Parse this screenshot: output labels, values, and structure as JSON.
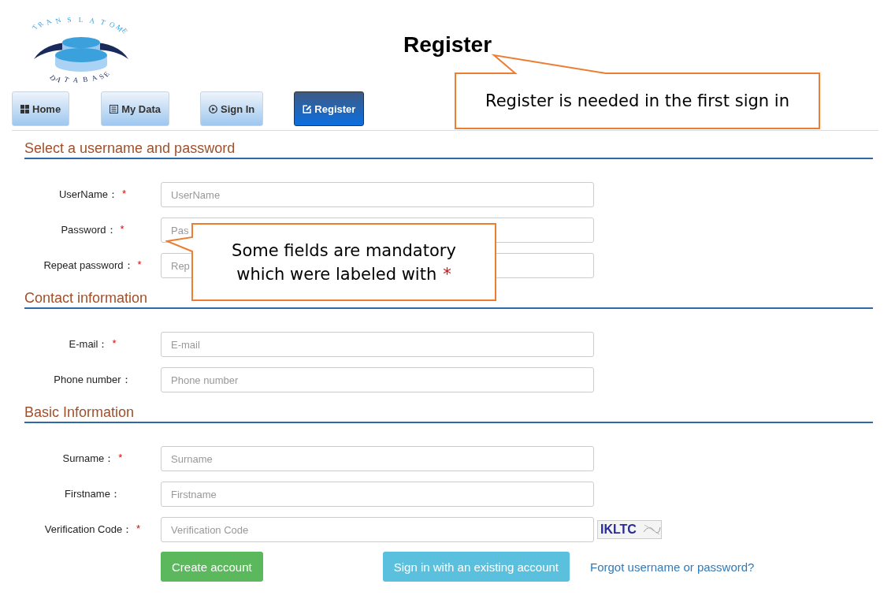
{
  "logo": {
    "top_text": "TRANSLATOME",
    "bottom_text": "DATABASE"
  },
  "title": "Register",
  "nav": [
    {
      "label": "Home",
      "selected": false
    },
    {
      "label": "My Data",
      "selected": false
    },
    {
      "label": "Sign In",
      "selected": false
    },
    {
      "label": "Register",
      "selected": true
    }
  ],
  "required_mark": "*",
  "sections": [
    {
      "heading": "Select a username and password",
      "fields": [
        {
          "label": "UserName：",
          "placeholder": "UserName",
          "required": true
        },
        {
          "label": "Password：",
          "placeholder": "Pas",
          "required": true
        },
        {
          "label": "Repeat password：",
          "placeholder": "Rep",
          "required": true
        }
      ]
    },
    {
      "heading": "Contact information",
      "fields": [
        {
          "label": "E-mail：",
          "placeholder": "E-mail",
          "required": true
        },
        {
          "label": "Phone number：",
          "placeholder": "Phone number",
          "required": false
        }
      ]
    },
    {
      "heading": "Basic Information",
      "fields": [
        {
          "label": "Surname：",
          "placeholder": "Surname",
          "required": true
        },
        {
          "label": "Firstname：",
          "placeholder": "Firstname",
          "required": false
        },
        {
          "label": "Verification Code：",
          "placeholder": "Verification Code",
          "required": true,
          "captcha": "IKLTC"
        }
      ]
    }
  ],
  "actions": [
    {
      "kind": "primary",
      "label": "Create account"
    },
    {
      "kind": "secondary",
      "label": "Sign in with an existing account"
    },
    {
      "kind": "link",
      "label": "Forgot username or password?"
    }
  ],
  "callouts": [
    {
      "kind": "top",
      "lines": [
        "Register is needed in the first sign in"
      ]
    },
    {
      "kind": "left",
      "lines": [
        "Some fields are mandatory",
        "which were labeled with"
      ],
      "mark": "*"
    }
  ]
}
